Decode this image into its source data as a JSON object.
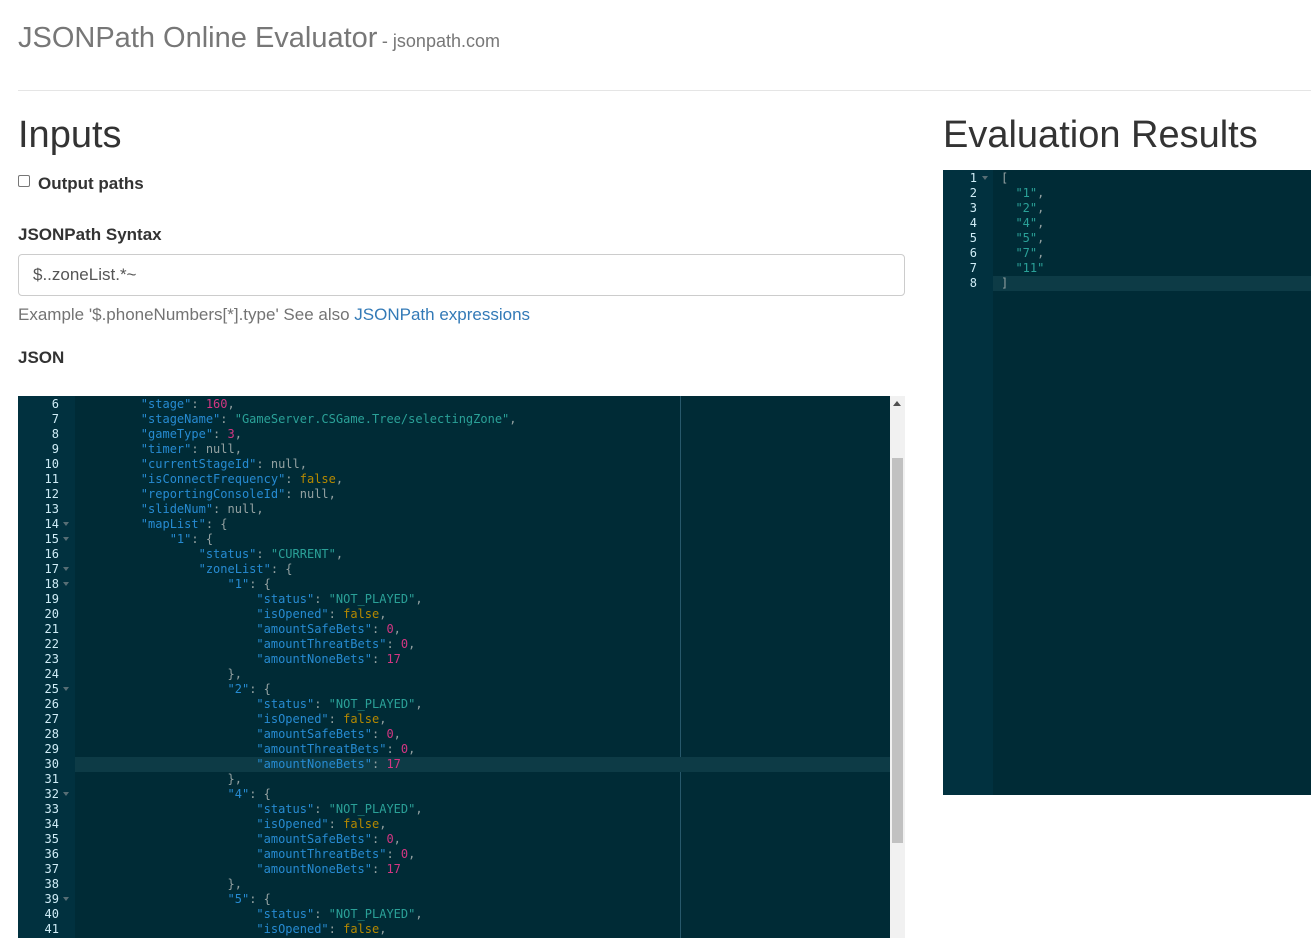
{
  "header": {
    "title": "JSONPath Online Evaluator",
    "subtitle": "- jsonpath.com"
  },
  "inputs": {
    "heading": "Inputs",
    "output_paths_label": "Output paths",
    "output_paths_checked": false,
    "syntax_label": "JSONPath Syntax",
    "syntax_value": "$..zoneList.*~",
    "help_text": "Example '$.phoneNumbers[*].type' See also ",
    "help_link": "JSONPath expressions",
    "json_label": "JSON"
  },
  "results": {
    "heading": "Evaluation Results"
  },
  "json_editor": {
    "active_line": 30,
    "fold_lines": [
      14,
      15,
      17,
      18,
      25,
      32,
      39
    ],
    "lines": [
      [
        6,
        8,
        [
          [
            "k",
            "\"stage\""
          ],
          [
            "p",
            ": "
          ],
          [
            "n",
            "160"
          ],
          [
            "p",
            ","
          ]
        ]
      ],
      [
        7,
        8,
        [
          [
            "k",
            "\"stageName\""
          ],
          [
            "p",
            ": "
          ],
          [
            "s",
            "\"GameServer.CSGame.Tree/selectingZone\""
          ],
          [
            "p",
            ","
          ]
        ]
      ],
      [
        8,
        8,
        [
          [
            "k",
            "\"gameType\""
          ],
          [
            "p",
            ": "
          ],
          [
            "n",
            "3"
          ],
          [
            "p",
            ","
          ]
        ]
      ],
      [
        9,
        8,
        [
          [
            "k",
            "\"timer\""
          ],
          [
            "p",
            ": null,"
          ]
        ]
      ],
      [
        10,
        8,
        [
          [
            "k",
            "\"currentStageId\""
          ],
          [
            "p",
            ": null,"
          ]
        ]
      ],
      [
        11,
        8,
        [
          [
            "k",
            "\"isConnectFrequency\""
          ],
          [
            "p",
            ": "
          ],
          [
            "b",
            "false"
          ],
          [
            "p",
            ","
          ]
        ]
      ],
      [
        12,
        8,
        [
          [
            "k",
            "\"reportingConsoleId\""
          ],
          [
            "p",
            ": null,"
          ]
        ]
      ],
      [
        13,
        8,
        [
          [
            "k",
            "\"slideNum\""
          ],
          [
            "p",
            ": null,"
          ]
        ]
      ],
      [
        14,
        8,
        [
          [
            "k",
            "\"mapList\""
          ],
          [
            "p",
            ": {"
          ]
        ]
      ],
      [
        15,
        12,
        [
          [
            "k",
            "\"1\""
          ],
          [
            "p",
            ": {"
          ]
        ]
      ],
      [
        16,
        16,
        [
          [
            "k",
            "\"status\""
          ],
          [
            "p",
            ": "
          ],
          [
            "s",
            "\"CURRENT\""
          ],
          [
            "p",
            ","
          ]
        ]
      ],
      [
        17,
        16,
        [
          [
            "k",
            "\"zoneList\""
          ],
          [
            "p",
            ": {"
          ]
        ]
      ],
      [
        18,
        20,
        [
          [
            "k",
            "\"1\""
          ],
          [
            "p",
            ": {"
          ]
        ]
      ],
      [
        19,
        24,
        [
          [
            "k",
            "\"status\""
          ],
          [
            "p",
            ": "
          ],
          [
            "s",
            "\"NOT_PLAYED\""
          ],
          [
            "p",
            ","
          ]
        ]
      ],
      [
        20,
        24,
        [
          [
            "k",
            "\"isOpened\""
          ],
          [
            "p",
            ": "
          ],
          [
            "b",
            "false"
          ],
          [
            "p",
            ","
          ]
        ]
      ],
      [
        21,
        24,
        [
          [
            "k",
            "\"amountSafeBets\""
          ],
          [
            "p",
            ": "
          ],
          [
            "n",
            "0"
          ],
          [
            "p",
            ","
          ]
        ]
      ],
      [
        22,
        24,
        [
          [
            "k",
            "\"amountThreatBets\""
          ],
          [
            "p",
            ": "
          ],
          [
            "n",
            "0"
          ],
          [
            "p",
            ","
          ]
        ]
      ],
      [
        23,
        24,
        [
          [
            "k",
            "\"amountNoneBets\""
          ],
          [
            "p",
            ": "
          ],
          [
            "n",
            "17"
          ]
        ]
      ],
      [
        24,
        20,
        [
          [
            "p",
            "},"
          ]
        ]
      ],
      [
        25,
        20,
        [
          [
            "k",
            "\"2\""
          ],
          [
            "p",
            ": {"
          ]
        ]
      ],
      [
        26,
        24,
        [
          [
            "k",
            "\"status\""
          ],
          [
            "p",
            ": "
          ],
          [
            "s",
            "\"NOT_PLAYED\""
          ],
          [
            "p",
            ","
          ]
        ]
      ],
      [
        27,
        24,
        [
          [
            "k",
            "\"isOpened\""
          ],
          [
            "p",
            ": "
          ],
          [
            "b",
            "false"
          ],
          [
            "p",
            ","
          ]
        ]
      ],
      [
        28,
        24,
        [
          [
            "k",
            "\"amountSafeBets\""
          ],
          [
            "p",
            ": "
          ],
          [
            "n",
            "0"
          ],
          [
            "p",
            ","
          ]
        ]
      ],
      [
        29,
        24,
        [
          [
            "k",
            "\"amountThreatBets\""
          ],
          [
            "p",
            ": "
          ],
          [
            "n",
            "0"
          ],
          [
            "p",
            ","
          ]
        ]
      ],
      [
        30,
        24,
        [
          [
            "k",
            "\"amountNoneBets\""
          ],
          [
            "p",
            ": "
          ],
          [
            "n",
            "17"
          ]
        ]
      ],
      [
        31,
        20,
        [
          [
            "p",
            "},"
          ]
        ]
      ],
      [
        32,
        20,
        [
          [
            "k",
            "\"4\""
          ],
          [
            "p",
            ": {"
          ]
        ]
      ],
      [
        33,
        24,
        [
          [
            "k",
            "\"status\""
          ],
          [
            "p",
            ": "
          ],
          [
            "s",
            "\"NOT_PLAYED\""
          ],
          [
            "p",
            ","
          ]
        ]
      ],
      [
        34,
        24,
        [
          [
            "k",
            "\"isOpened\""
          ],
          [
            "p",
            ": "
          ],
          [
            "b",
            "false"
          ],
          [
            "p",
            ","
          ]
        ]
      ],
      [
        35,
        24,
        [
          [
            "k",
            "\"amountSafeBets\""
          ],
          [
            "p",
            ": "
          ],
          [
            "n",
            "0"
          ],
          [
            "p",
            ","
          ]
        ]
      ],
      [
        36,
        24,
        [
          [
            "k",
            "\"amountThreatBets\""
          ],
          [
            "p",
            ": "
          ],
          [
            "n",
            "0"
          ],
          [
            "p",
            ","
          ]
        ]
      ],
      [
        37,
        24,
        [
          [
            "k",
            "\"amountNoneBets\""
          ],
          [
            "p",
            ": "
          ],
          [
            "n",
            "17"
          ]
        ]
      ],
      [
        38,
        20,
        [
          [
            "p",
            "},"
          ]
        ]
      ],
      [
        39,
        20,
        [
          [
            "k",
            "\"5\""
          ],
          [
            "p",
            ": {"
          ]
        ]
      ],
      [
        40,
        24,
        [
          [
            "k",
            "\"status\""
          ],
          [
            "p",
            ": "
          ],
          [
            "s",
            "\"NOT_PLAYED\""
          ],
          [
            "p",
            ","
          ]
        ]
      ],
      [
        41,
        24,
        [
          [
            "k",
            "\"isOpened\""
          ],
          [
            "p",
            ": "
          ],
          [
            "b",
            "false"
          ],
          [
            "p",
            ","
          ]
        ]
      ]
    ]
  },
  "result_editor": {
    "active_line": 8,
    "fold_lines": [
      1
    ],
    "lines": [
      [
        1,
        0,
        [
          [
            "p",
            "["
          ]
        ]
      ],
      [
        2,
        2,
        [
          [
            "s",
            "\"1\""
          ],
          [
            "p",
            ","
          ]
        ]
      ],
      [
        3,
        2,
        [
          [
            "s",
            "\"2\""
          ],
          [
            "p",
            ","
          ]
        ]
      ],
      [
        4,
        2,
        [
          [
            "s",
            "\"4\""
          ],
          [
            "p",
            ","
          ]
        ]
      ],
      [
        5,
        2,
        [
          [
            "s",
            "\"5\""
          ],
          [
            "p",
            ","
          ]
        ]
      ],
      [
        6,
        2,
        [
          [
            "s",
            "\"7\""
          ],
          [
            "p",
            ","
          ]
        ]
      ],
      [
        7,
        2,
        [
          [
            "s",
            "\"11\""
          ]
        ]
      ],
      [
        8,
        0,
        [
          [
            "p",
            "]"
          ]
        ]
      ]
    ]
  }
}
